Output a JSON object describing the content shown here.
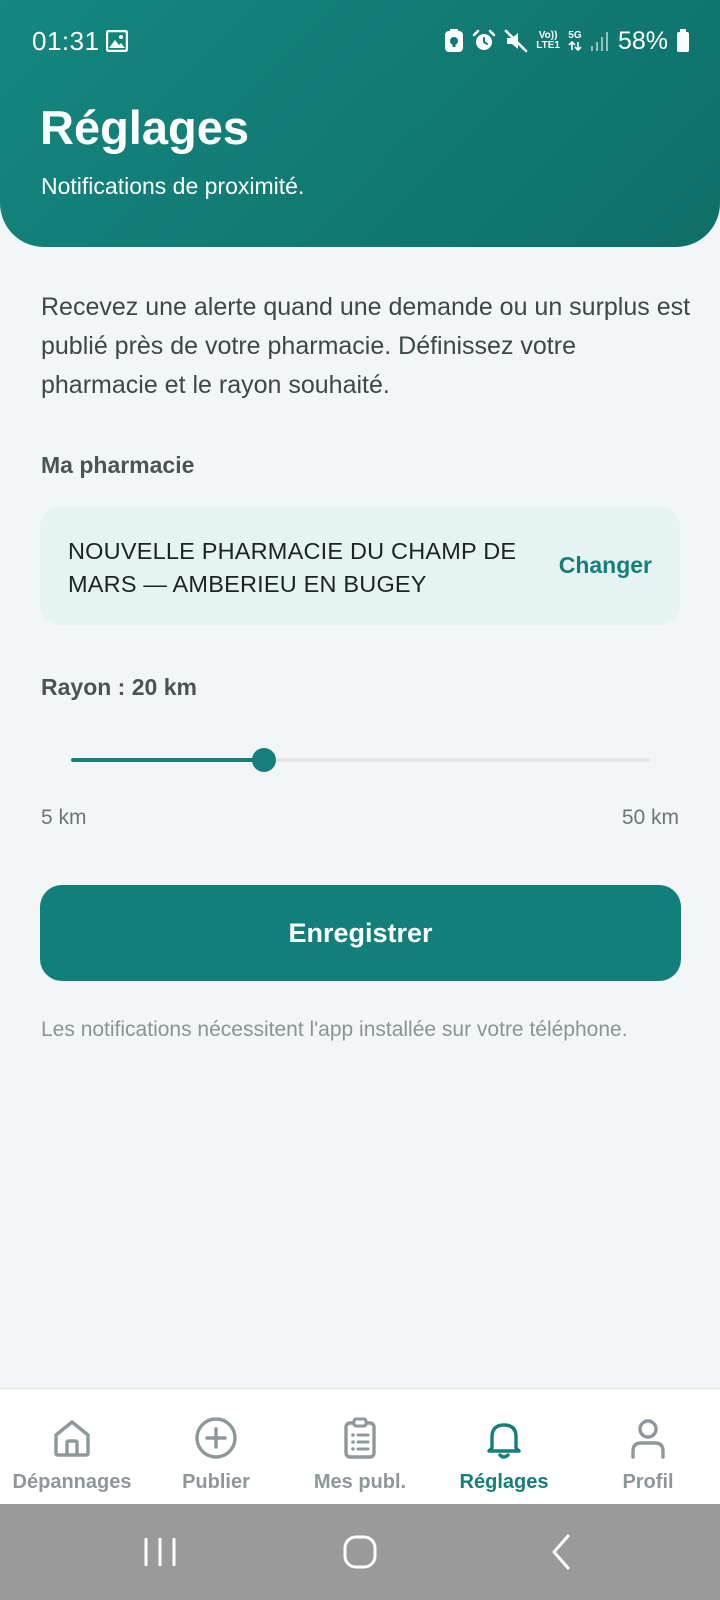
{
  "status_bar": {
    "time": "01:31",
    "network_volte": "Vo))",
    "network_lte": "LTE1",
    "network_5g": "5G",
    "battery": "58%"
  },
  "header": {
    "title": "Réglages",
    "subtitle": "Notifications de proximité."
  },
  "intro_text": "Recevez une alerte quand une demande ou un surplus est publié près de votre pharmacie. Définissez votre pharmacie et le rayon souhaité.",
  "pharmacy": {
    "label": "Ma pharmacie",
    "name": "NOUVELLE PHARMACIE DU CHAMP DE MARS — AMBERIEU EN BUGEY",
    "change_label": "Changer"
  },
  "radius": {
    "label": "Rayon : 20 km",
    "value_km": 20,
    "min_km": 5,
    "max_km": 50,
    "min_label": "5 km",
    "max_label": "50 km"
  },
  "save_label": "Enregistrer",
  "note": "Les notifications nécessitent l'app installée sur votre téléphone.",
  "bottom_nav": {
    "active": "Réglages",
    "items": [
      {
        "label": "Dépannages",
        "icon": "home-icon"
      },
      {
        "label": "Publier",
        "icon": "plus-circle-icon"
      },
      {
        "label": "Mes publ.",
        "icon": "clipboard-list-icon"
      },
      {
        "label": "Réglages",
        "icon": "bell-icon"
      },
      {
        "label": "Profil",
        "icon": "user-icon"
      }
    ]
  },
  "colors": {
    "primary": "#137f7a",
    "header_start": "#14877f",
    "header_end": "#0f6f69",
    "card_background": "#e6f3f3",
    "page_background": "#f3f6f7",
    "inactive_nav": "#8e9799",
    "system_nav_bar": "#9a9a9a"
  }
}
